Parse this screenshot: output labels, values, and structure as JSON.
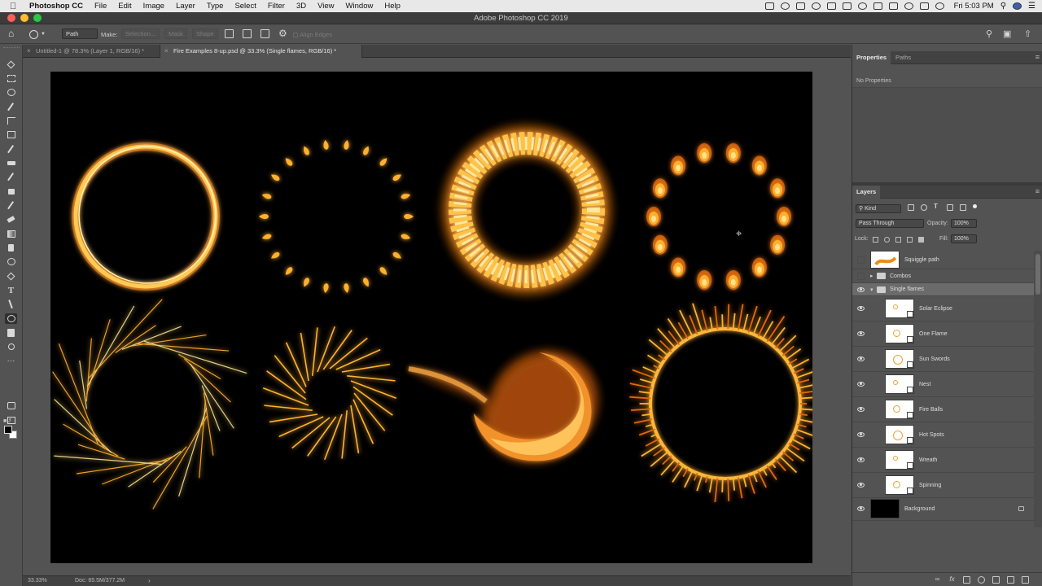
{
  "menubar": {
    "app_name": "Photoshop CC",
    "items": [
      "File",
      "Edit",
      "Image",
      "Layer",
      "Type",
      "Select",
      "Filter",
      "3D",
      "View",
      "Window",
      "Help"
    ],
    "clock": "Fri 5:03 PM"
  },
  "window": {
    "title": "Adobe Photoshop CC 2019"
  },
  "options": {
    "mode_value": "Path",
    "make_label": "Make:",
    "selection_label": "Selection...",
    "mask_label": "Mask",
    "shape_label": "Shape",
    "align_edges_label": "Align Edges"
  },
  "tabs": [
    {
      "label": "Untitled-1 @ 78.3% (Layer 1, RGB/16) *",
      "close": "×"
    },
    {
      "label": "Fire Examples 8-up.psd @ 33.3% (Single flames, RGB/16) *",
      "close": "×"
    }
  ],
  "status": {
    "zoom": "33.33%",
    "doc": "Doc: 65.5M/377.2M",
    "arrow": "›"
  },
  "properties": {
    "tabs": [
      "Properties",
      "Paths"
    ],
    "empty_text": "No Properties"
  },
  "layers_panel": {
    "title": "Layers",
    "filter_kind": "Kind",
    "blend_mode": "Pass Through",
    "opacity_label": "Opacity:",
    "opacity_value": "100%",
    "lock_label": "Lock:",
    "fill_label": "Fill:",
    "fill_value": "100%",
    "layers": [
      {
        "name": "Squiggle path",
        "visible": false,
        "kind": "layer"
      },
      {
        "name": "Combos",
        "visible": false,
        "kind": "group"
      },
      {
        "name": "Single flames",
        "visible": true,
        "kind": "group-open"
      },
      {
        "name": "Solar Eclipse",
        "visible": true,
        "kind": "smart"
      },
      {
        "name": "One Flame",
        "visible": true,
        "kind": "smart"
      },
      {
        "name": "Sun Swords",
        "visible": true,
        "kind": "smart"
      },
      {
        "name": "Nest",
        "visible": true,
        "kind": "smart"
      },
      {
        "name": "Fire Balls",
        "visible": true,
        "kind": "smart"
      },
      {
        "name": "Hot Spots",
        "visible": true,
        "kind": "smart"
      },
      {
        "name": "Wreath",
        "visible": true,
        "kind": "smart"
      },
      {
        "name": "Spinning",
        "visible": true,
        "kind": "smart"
      },
      {
        "name": "Background",
        "visible": true,
        "kind": "background"
      }
    ]
  },
  "colors": {
    "fire_core": "#ffe28a",
    "fire_mid": "#ffb12e",
    "fire_edge": "#e06a10",
    "panel_bg": "#535353",
    "canvas_bg": "#000000"
  }
}
